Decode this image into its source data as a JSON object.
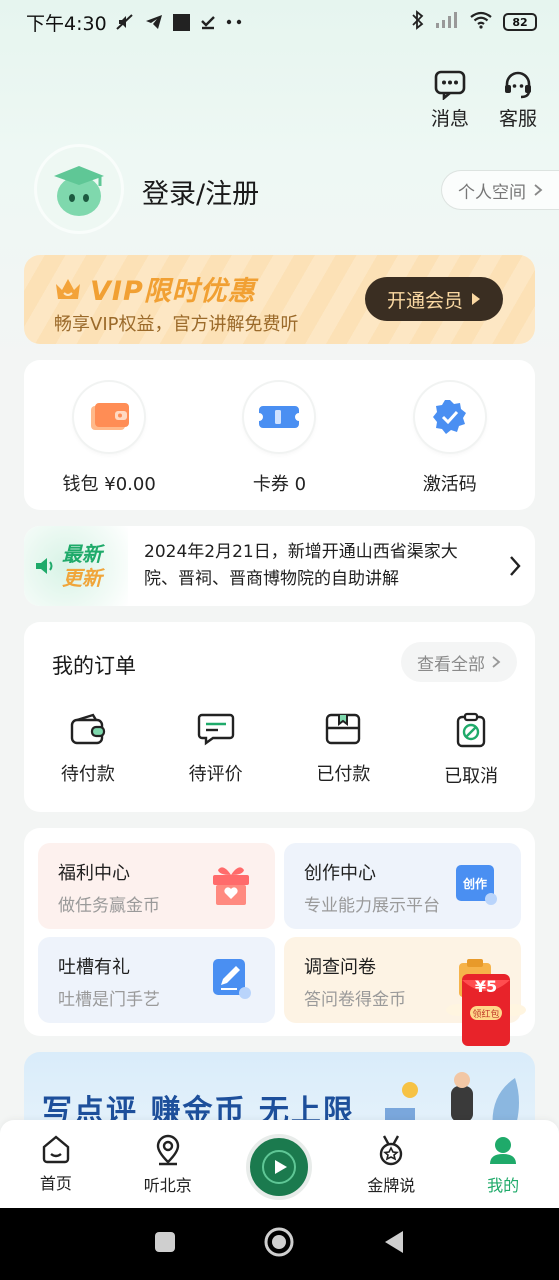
{
  "status_bar": {
    "time": "下午4:30",
    "battery": "82"
  },
  "top_actions": {
    "messages": "消息",
    "service": "客服"
  },
  "profile": {
    "login": "登录/注册",
    "space": "个人空间"
  },
  "vip": {
    "title": "VIP限时优惠",
    "subtitle": "畅享VIP权益，官方讲解免费听",
    "button": "开通会员"
  },
  "wallet": {
    "items": [
      {
        "label": "钱包 ¥0.00",
        "icon": "wallet-icon"
      },
      {
        "label": "卡券 0",
        "icon": "coupon-icon"
      },
      {
        "label": "激活码",
        "icon": "activation-icon"
      }
    ]
  },
  "news": {
    "badge_line1": "最新",
    "badge_line2": "更新",
    "text": "2024年2月21日，新增开通山西省渠家大院、晋祠、晋商博物院的自助讲解"
  },
  "orders": {
    "title": "我的订单",
    "view_all": "查看全部",
    "items": [
      {
        "label": "待付款",
        "icon": "wallet-outline-icon"
      },
      {
        "label": "待评价",
        "icon": "comment-icon"
      },
      {
        "label": "已付款",
        "icon": "paid-icon"
      },
      {
        "label": "已取消",
        "icon": "cancelled-icon"
      }
    ]
  },
  "features": [
    {
      "title": "福利中心",
      "subtitle": "做任务赢金币",
      "icon": "gift-icon"
    },
    {
      "title": "创作中心",
      "subtitle": "专业能力展示平台",
      "icon": "creation-icon",
      "badge": "创作"
    },
    {
      "title": "吐槽有礼",
      "subtitle": "吐槽是门手艺",
      "icon": "feedback-icon"
    },
    {
      "title": "调查问卷",
      "subtitle": "答问卷得金币",
      "icon": "survey-icon"
    }
  ],
  "red_packet": {
    "amount": "¥5",
    "label": "领红包"
  },
  "promo": {
    "text": "写点评 赚金币 无上限"
  },
  "tabbar": {
    "items": [
      {
        "label": "首页",
        "icon": "home-icon"
      },
      {
        "label": "听北京",
        "icon": "location-icon"
      },
      {
        "label": "",
        "icon": "play-icon"
      },
      {
        "label": "金牌说",
        "icon": "medal-icon"
      },
      {
        "label": "我的",
        "icon": "profile-icon"
      }
    ]
  },
  "colors": {
    "accent": "#1faa6a",
    "vip_text": "#f1a033",
    "vip_button": "#3a2e22"
  }
}
